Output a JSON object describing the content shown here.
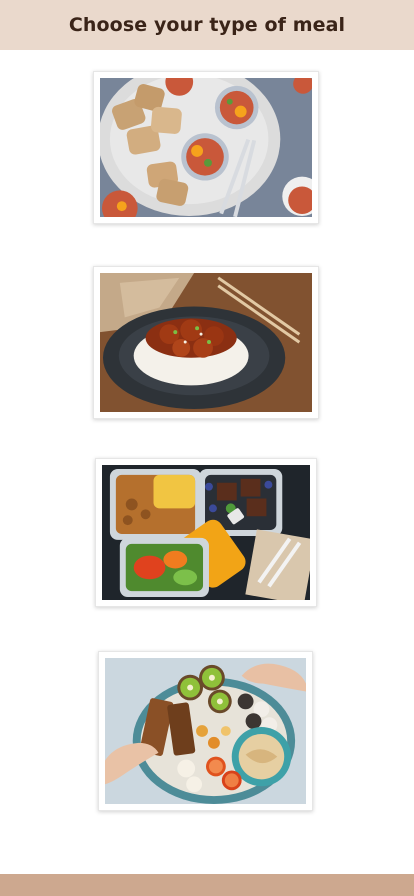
{
  "header": {
    "title": "Choose your type of meal",
    "background": "#ead9cc",
    "text_color": "#3a2418"
  },
  "meal_options": [
    {
      "icon": "breakfast-eggs-toast-photo"
    },
    {
      "icon": "chicken-rice-bowl-photo"
    },
    {
      "icon": "meal-prep-containers-photo"
    },
    {
      "icon": "snack-platter-photo"
    }
  ],
  "footer": {
    "background": "#cda88f"
  }
}
